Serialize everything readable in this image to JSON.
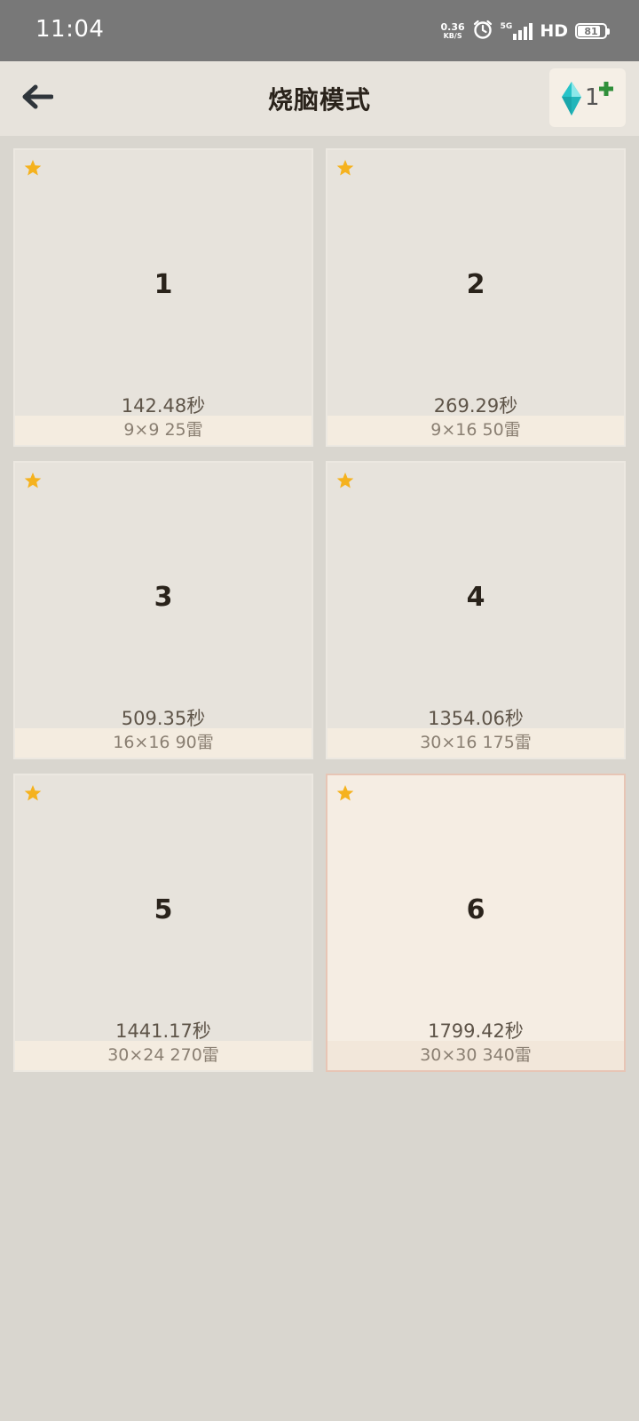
{
  "status_bar": {
    "time": "11:04",
    "net_speed": "0.36",
    "net_unit": "KB/S",
    "signal": "5G",
    "hd": "HD",
    "battery": "81"
  },
  "header": {
    "title": "烧脑模式",
    "gem_count": "1"
  },
  "levels": [
    {
      "number": "1",
      "time": "142.48秒",
      "info": "9×9  25雷",
      "starred": true
    },
    {
      "number": "2",
      "time": "269.29秒",
      "info": "9×16  50雷",
      "starred": true
    },
    {
      "number": "3",
      "time": "509.35秒",
      "info": "16×16  90雷",
      "starred": true
    },
    {
      "number": "4",
      "time": "1354.06秒",
      "info": "30×16  175雷",
      "starred": true
    },
    {
      "number": "5",
      "time": "1441.17秒",
      "info": "30×24  270雷",
      "starred": true
    },
    {
      "number": "6",
      "time": "1799.42秒",
      "info": "30×30  340雷",
      "starred": true,
      "selected": true
    }
  ],
  "colors": {
    "star": "#f5b21e",
    "gem": "#27c3c8",
    "plus": "#2f8f3a",
    "selected_border": "#e7c5b5"
  }
}
